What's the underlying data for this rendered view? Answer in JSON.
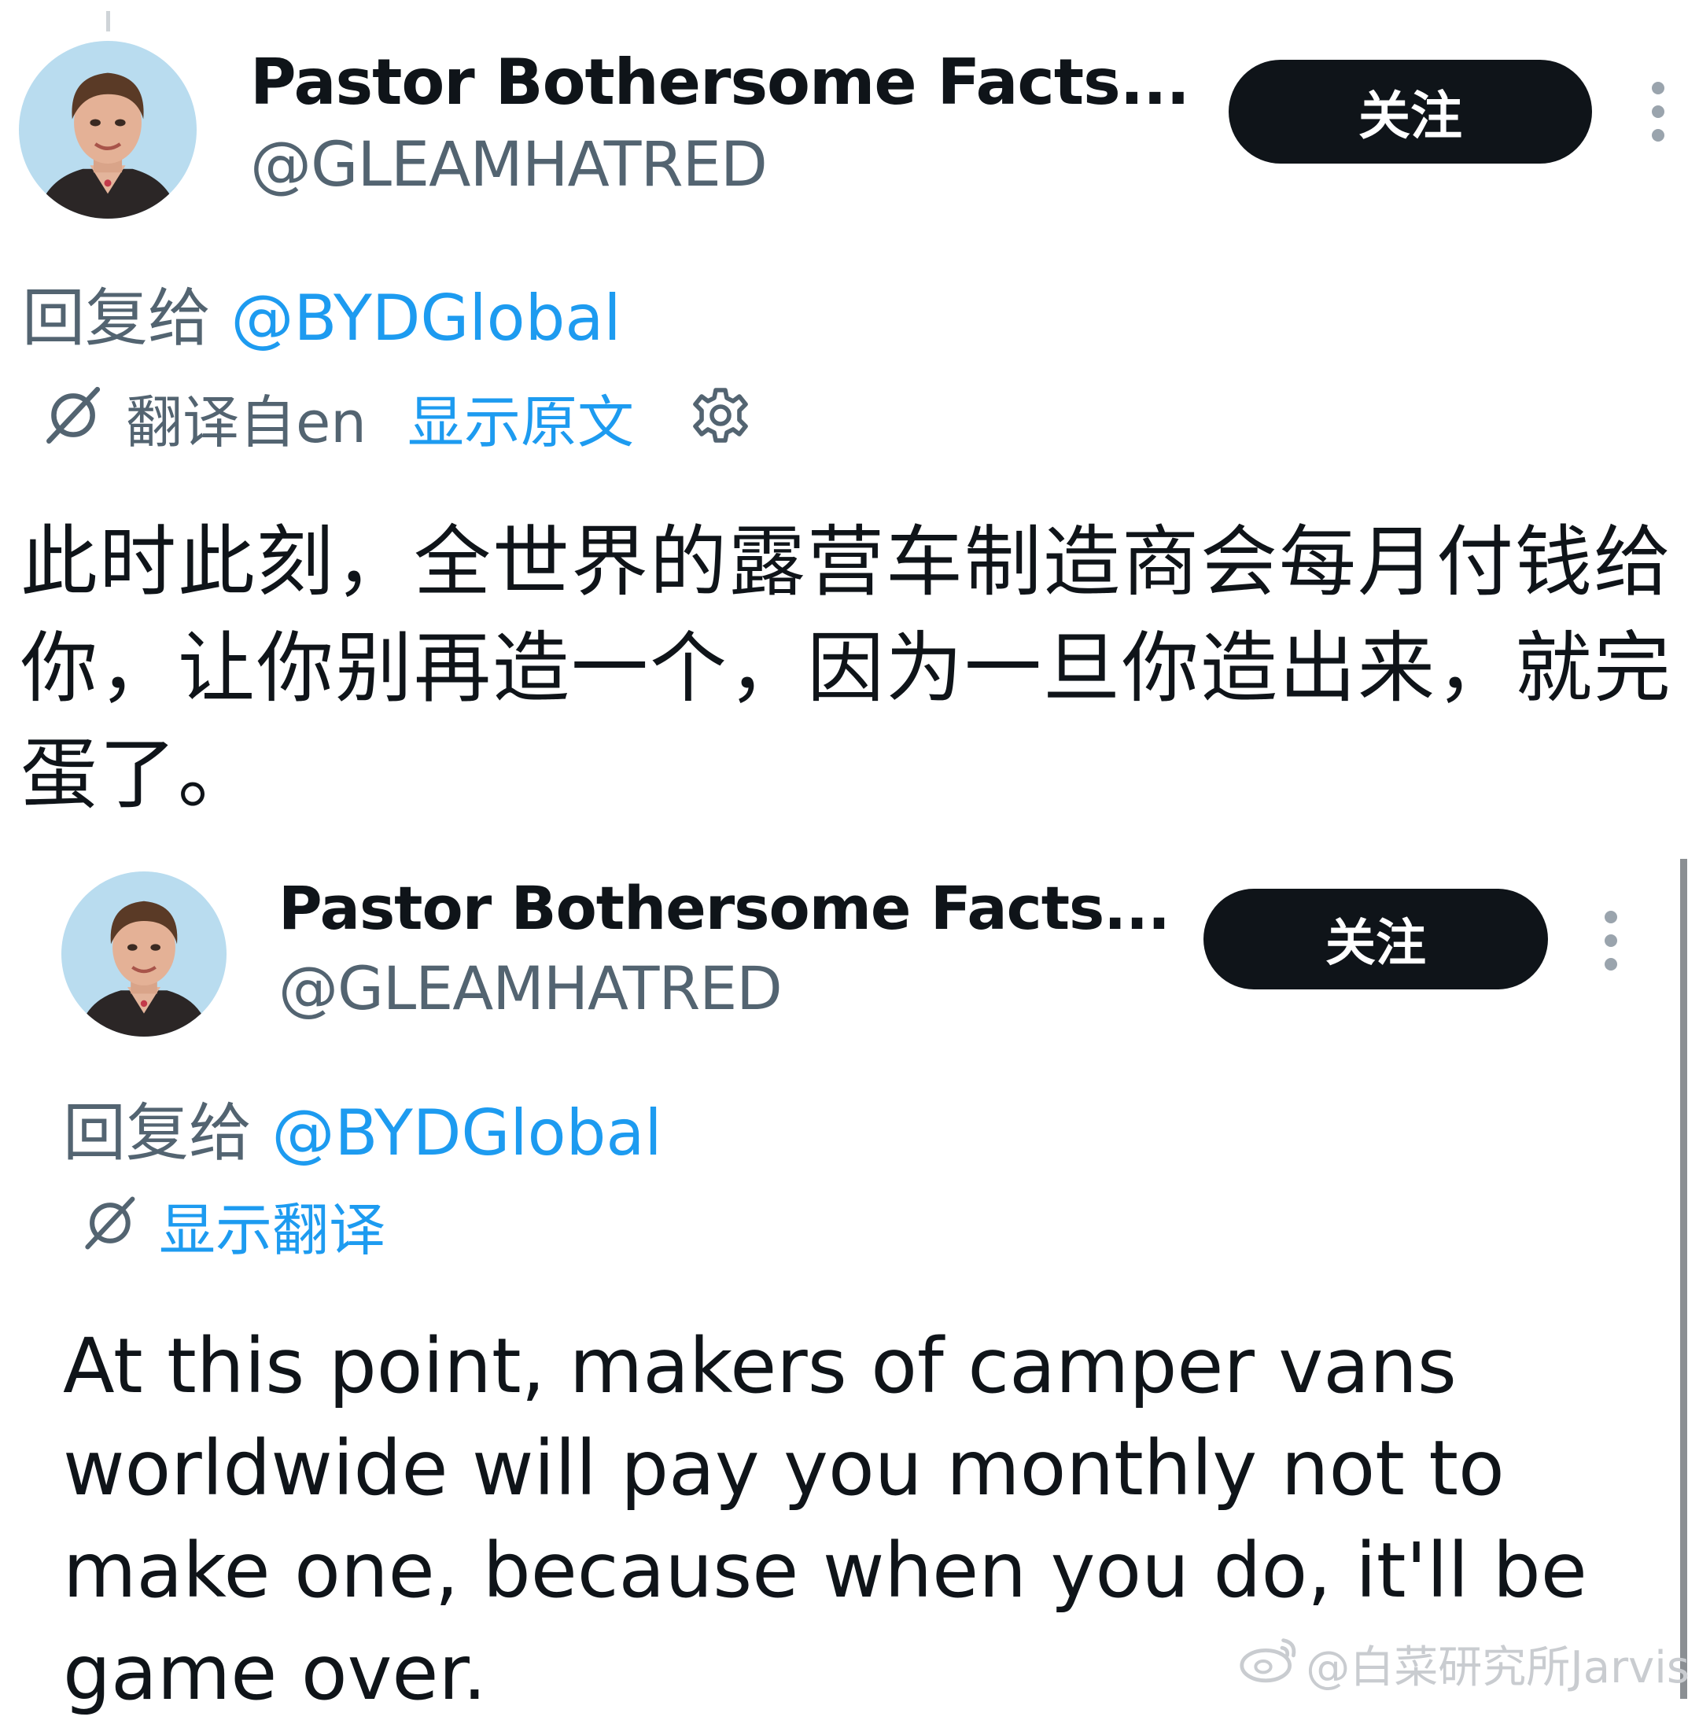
{
  "tweet_main": {
    "display_name": "Pastor Bothersome Facts...",
    "handle": "@GLEAMHATRED",
    "follow_label": "关注",
    "reply_prefix": "回复给",
    "reply_mention": "@BYDGlobal",
    "translated_label": "翻译自en",
    "show_original_label": "显示原文",
    "body": "此时此刻，全世界的露营车制造商会每月付钱给你，让你别再造一个，因为一旦你造出来，就完蛋了。"
  },
  "tweet_quoted": {
    "display_name": "Pastor Bothersome Facts...",
    "handle": "@GLEAMHATRED",
    "follow_label": "关注",
    "reply_prefix": "回复给",
    "reply_mention": "@BYDGlobal",
    "show_translation_label": "显示翻译",
    "body": "At this point, makers of camper vans worldwide will pay you monthly not to make one, because when you do, it'll be game over."
  },
  "watermark": {
    "text": "@白菜研究所Jarvis",
    "icon": "weibo-icon"
  },
  "colors": {
    "link": "#1d9bf0",
    "button_bg": "#0f1419",
    "muted_text": "#536471"
  }
}
